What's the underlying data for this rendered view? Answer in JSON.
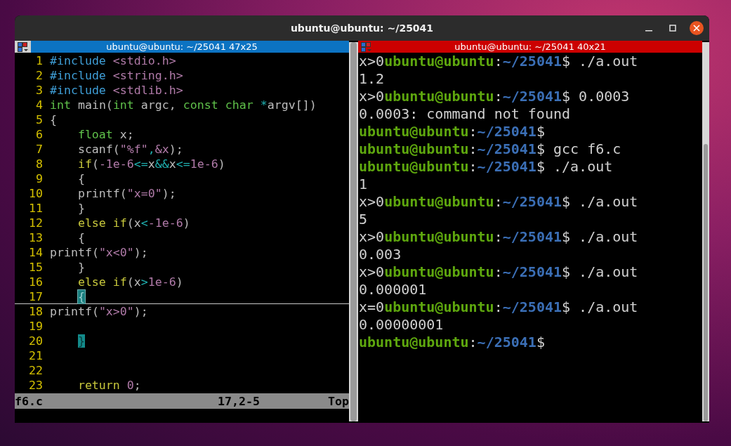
{
  "window": {
    "title": "ubuntu@ubuntu: ~/25041"
  },
  "editor_pane": {
    "title": "ubuntu@ubuntu: ~/25041 47x25",
    "focused": false,
    "lines": [
      {
        "number": "1",
        "indented": false,
        "tokens": [
          {
            "kind": "preproc",
            "text": "#include"
          },
          {
            "kind": "string",
            "text": " <stdio.h>"
          }
        ]
      },
      {
        "number": "2",
        "indented": false,
        "tokens": [
          {
            "kind": "preproc",
            "text": "#include"
          },
          {
            "kind": "string",
            "text": " <string.h>"
          }
        ]
      },
      {
        "number": "3",
        "indented": false,
        "tokens": [
          {
            "kind": "preproc",
            "text": "#include"
          },
          {
            "kind": "string",
            "text": " <stdlib.h>"
          }
        ]
      },
      {
        "number": "4",
        "indented": false,
        "tokens": [
          {
            "kind": "type",
            "text": "int"
          },
          {
            "kind": "plain",
            "text": " main("
          },
          {
            "kind": "type",
            "text": "int"
          },
          {
            "kind": "plain",
            "text": " argc, "
          },
          {
            "kind": "type",
            "text": "const char"
          },
          {
            "kind": "operator",
            "text": " *"
          },
          {
            "kind": "plain",
            "text": "argv[])"
          }
        ]
      },
      {
        "number": "5",
        "indented": false,
        "tokens": [
          {
            "kind": "plain",
            "text": "{"
          }
        ]
      },
      {
        "number": "6",
        "indented": true,
        "tokens": [
          {
            "kind": "type",
            "text": "float"
          },
          {
            "kind": "plain",
            "text": " x;"
          }
        ]
      },
      {
        "number": "7",
        "indented": true,
        "tokens": [
          {
            "kind": "plain",
            "text": "scanf("
          },
          {
            "kind": "string",
            "text": "\"%f\""
          },
          {
            "kind": "operator",
            "text": ","
          },
          {
            "kind": "string",
            "text": "&x"
          },
          {
            "kind": "plain",
            "text": ");"
          }
        ]
      },
      {
        "number": "8",
        "indented": true,
        "tokens": [
          {
            "kind": "keyword",
            "text": "if"
          },
          {
            "kind": "plain",
            "text": "("
          },
          {
            "kind": "number",
            "text": "-1e-6"
          },
          {
            "kind": "operator",
            "text": "<="
          },
          {
            "kind": "plain",
            "text": "x"
          },
          {
            "kind": "operator",
            "text": "&&"
          },
          {
            "kind": "plain",
            "text": "x"
          },
          {
            "kind": "operator",
            "text": "<="
          },
          {
            "kind": "number",
            "text": "1e-6"
          },
          {
            "kind": "plain",
            "text": ")"
          }
        ]
      },
      {
        "number": "9",
        "indented": true,
        "tokens": [
          {
            "kind": "plain",
            "text": "{"
          }
        ]
      },
      {
        "number": "10",
        "indented": true,
        "tokens": [
          {
            "kind": "plain",
            "text": "printf("
          },
          {
            "kind": "string",
            "text": "\"x=0\""
          },
          {
            "kind": "plain",
            "text": ");"
          }
        ]
      },
      {
        "number": "11",
        "indented": true,
        "tokens": [
          {
            "kind": "plain",
            "text": "}"
          }
        ]
      },
      {
        "number": "12",
        "indented": true,
        "tokens": [
          {
            "kind": "keyword",
            "text": "else if"
          },
          {
            "kind": "plain",
            "text": "(x"
          },
          {
            "kind": "operator",
            "text": "<"
          },
          {
            "kind": "number",
            "text": "-1e-6"
          },
          {
            "kind": "plain",
            "text": ")"
          }
        ]
      },
      {
        "number": "13",
        "indented": true,
        "tokens": [
          {
            "kind": "plain",
            "text": "{"
          }
        ]
      },
      {
        "number": "14",
        "indented": false,
        "tokens": [
          {
            "kind": "plain",
            "text": "printf("
          },
          {
            "kind": "string",
            "text": "\"x<0\""
          },
          {
            "kind": "plain",
            "text": ");"
          }
        ]
      },
      {
        "number": "15",
        "indented": true,
        "tokens": [
          {
            "kind": "plain",
            "text": "}"
          }
        ]
      },
      {
        "number": "16",
        "indented": true,
        "tokens": [
          {
            "kind": "keyword",
            "text": "else if"
          },
          {
            "kind": "plain",
            "text": "(x"
          },
          {
            "kind": "operator",
            "text": ">"
          },
          {
            "kind": "number",
            "text": "1e-6"
          },
          {
            "kind": "plain",
            "text": ")"
          }
        ]
      },
      {
        "number": "17",
        "indented": true,
        "cursorline": true,
        "tokens": [
          {
            "kind": "cursor",
            "text": "{"
          }
        ]
      },
      {
        "number": "18",
        "indented": false,
        "tokens": [
          {
            "kind": "plain",
            "text": "printf("
          },
          {
            "kind": "string",
            "text": "\"x>0\""
          },
          {
            "kind": "plain",
            "text": ");"
          }
        ]
      },
      {
        "number": "19"
      },
      {
        "number": "20",
        "indented": true,
        "tokens": [
          {
            "kind": "match",
            "text": "}"
          }
        ]
      },
      {
        "number": "21"
      },
      {
        "number": "22"
      },
      {
        "number": "23",
        "indented": true,
        "tokens": [
          {
            "kind": "keyword",
            "text": "return"
          },
          {
            "kind": "number",
            "text": " 0"
          },
          {
            "kind": "plain",
            "text": ";"
          }
        ]
      }
    ],
    "status_bar": {
      "file": "f6.c",
      "position": "17,2-5",
      "scroll": "Top"
    }
  },
  "terminal_pane": {
    "title": "ubuntu@ubuntu: ~/25041 40x21",
    "focused": true,
    "lines": [
      [
        {
          "kind": "output",
          "text": "x>0"
        },
        {
          "kind": "user",
          "text": "ubuntu@ubuntu"
        },
        {
          "kind": "output",
          "text": ":"
        },
        {
          "kind": "path",
          "text": "~/25041"
        },
        {
          "kind": "output",
          "text": "$ ./a.out"
        }
      ],
      [
        {
          "kind": "output",
          "text": "1.2"
        }
      ],
      [
        {
          "kind": "output",
          "text": "x>0"
        },
        {
          "kind": "user",
          "text": "ubuntu@ubuntu"
        },
        {
          "kind": "output",
          "text": ":"
        },
        {
          "kind": "path",
          "text": "~/25041"
        },
        {
          "kind": "output",
          "text": "$ 0.0003"
        }
      ],
      [
        {
          "kind": "output",
          "text": "0.0003: command not found"
        }
      ],
      [
        {
          "kind": "user",
          "text": "ubuntu@ubuntu"
        },
        {
          "kind": "output",
          "text": ":"
        },
        {
          "kind": "path",
          "text": "~/25041"
        },
        {
          "kind": "output",
          "text": "$"
        }
      ],
      [
        {
          "kind": "user",
          "text": "ubuntu@ubuntu"
        },
        {
          "kind": "output",
          "text": ":"
        },
        {
          "kind": "path",
          "text": "~/25041"
        },
        {
          "kind": "output",
          "text": "$ gcc f6.c"
        }
      ],
      [
        {
          "kind": "user",
          "text": "ubuntu@ubuntu"
        },
        {
          "kind": "output",
          "text": ":"
        },
        {
          "kind": "path",
          "text": "~/25041"
        },
        {
          "kind": "output",
          "text": "$ ./a.out"
        }
      ],
      [
        {
          "kind": "output",
          "text": "1"
        }
      ],
      [
        {
          "kind": "output",
          "text": "x>0"
        },
        {
          "kind": "user",
          "text": "ubuntu@ubuntu"
        },
        {
          "kind": "output",
          "text": ":"
        },
        {
          "kind": "path",
          "text": "~/25041"
        },
        {
          "kind": "output",
          "text": "$ ./a.out"
        }
      ],
      [
        {
          "kind": "output",
          "text": "5"
        }
      ],
      [
        {
          "kind": "output",
          "text": "x>0"
        },
        {
          "kind": "user",
          "text": "ubuntu@ubuntu"
        },
        {
          "kind": "output",
          "text": ":"
        },
        {
          "kind": "path",
          "text": "~/25041"
        },
        {
          "kind": "output",
          "text": "$ ./a.out"
        }
      ],
      [
        {
          "kind": "output",
          "text": "0.003"
        }
      ],
      [
        {
          "kind": "output",
          "text": "x>0"
        },
        {
          "kind": "user",
          "text": "ubuntu@ubuntu"
        },
        {
          "kind": "output",
          "text": ":"
        },
        {
          "kind": "path",
          "text": "~/25041"
        },
        {
          "kind": "output",
          "text": "$ ./a.out"
        }
      ],
      [
        {
          "kind": "output",
          "text": "0.000001"
        }
      ],
      [
        {
          "kind": "output",
          "text": "x=0"
        },
        {
          "kind": "user",
          "text": "ubuntu@ubuntu"
        },
        {
          "kind": "output",
          "text": ":"
        },
        {
          "kind": "path",
          "text": "~/25041"
        },
        {
          "kind": "output",
          "text": "$ ./a.out"
        }
      ],
      [
        {
          "kind": "output",
          "text": "0.00000001"
        }
      ],
      [
        {
          "kind": "user",
          "text": "ubuntu@ubuntu"
        },
        {
          "kind": "output",
          "text": ":"
        },
        {
          "kind": "path",
          "text": "~/25041"
        },
        {
          "kind": "output",
          "text": "$"
        }
      ]
    ]
  }
}
